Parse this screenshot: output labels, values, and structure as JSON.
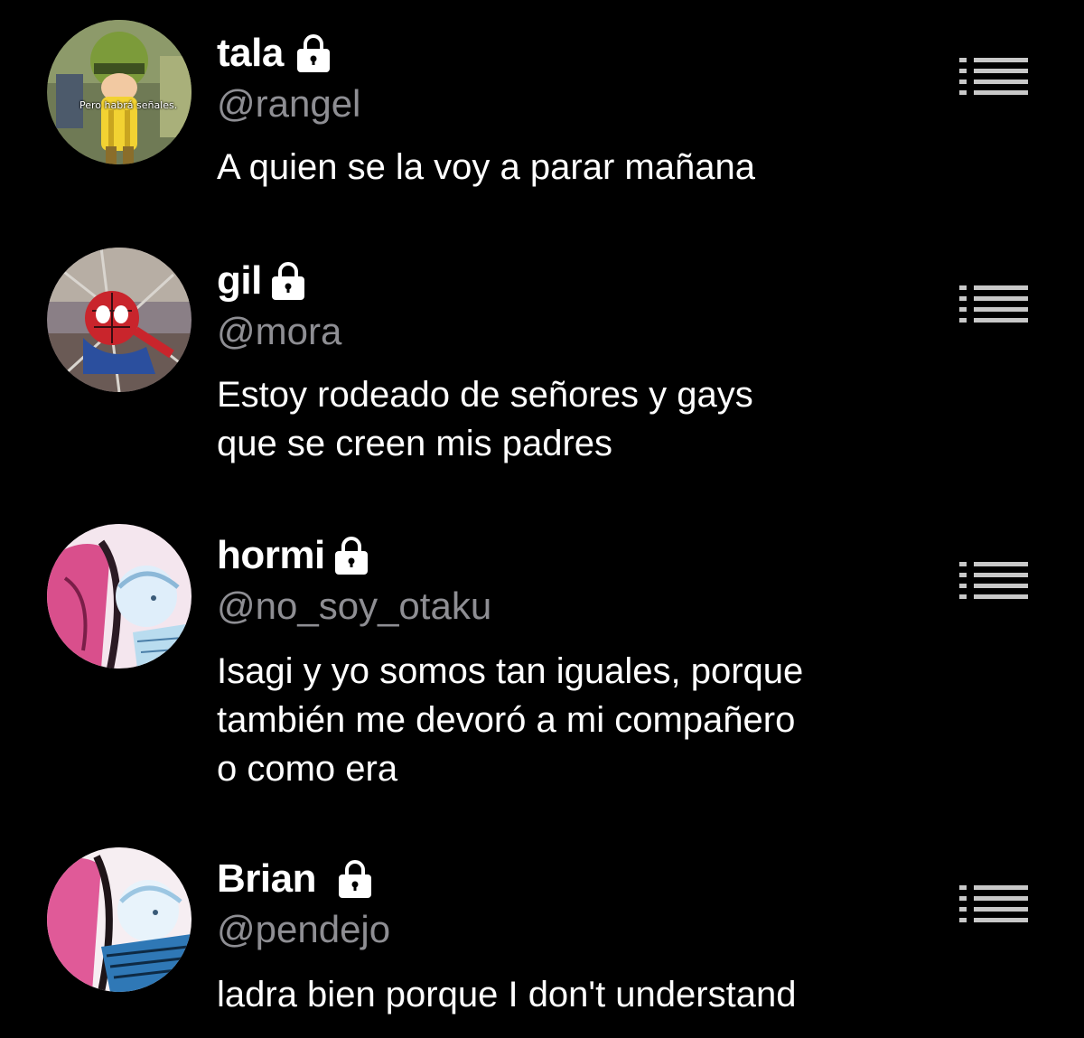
{
  "posts": [
    {
      "display_name": "tala",
      "handle": "@rangel",
      "lines": [
        "A quien se la voy a parar mañana"
      ],
      "locked": true,
      "avatar_caption": "Pero habrá señales.",
      "avatar_theme": "cartoon-yellow"
    },
    {
      "display_name": "gil",
      "handle": "@mora",
      "lines": [
        "Estoy rodeado de señores y gays",
        "que se creen mis padres"
      ],
      "locked": true,
      "avatar_theme": "spider-man-comic"
    },
    {
      "display_name": "hormi",
      "handle": "@no_soy_otaku",
      "lines": [
        "Isagi y yo somos tan iguales, porque",
        "también me devoró a mi compañero",
        "o como era"
      ],
      "locked": true,
      "avatar_theme": "anime-pink"
    },
    {
      "display_name": "Brian",
      "handle": "@pendejo",
      "lines": [
        "ladra bien porque I don't understand"
      ],
      "locked": true,
      "avatar_theme": "anime-pink-blue"
    }
  ],
  "icons": {
    "lock": "lock-icon",
    "menu": "list-menu-icon"
  },
  "colors": {
    "background": "#000000",
    "text": "#ffffff",
    "handle": "#8e8e93",
    "menu_icon": "#c8c8c8"
  }
}
